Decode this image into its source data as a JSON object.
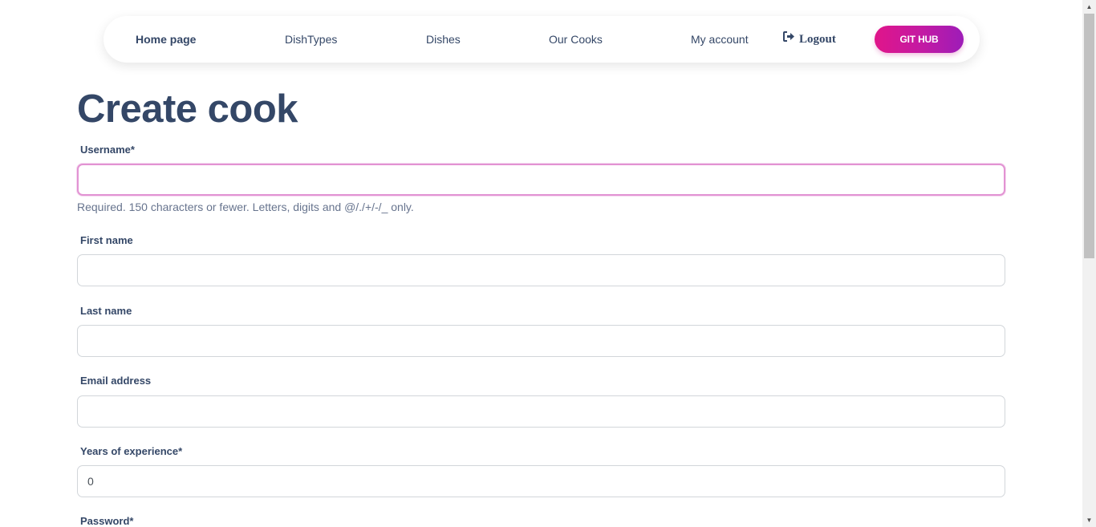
{
  "nav": {
    "items": [
      {
        "label": "Home page"
      },
      {
        "label": "DishTypes"
      },
      {
        "label": "Dishes"
      },
      {
        "label": "Our Cooks"
      },
      {
        "label": "My account"
      }
    ],
    "logout_label": "Logout",
    "github_label": "GIT HUB"
  },
  "page": {
    "title": "Create cook"
  },
  "form": {
    "username": {
      "label": "Username*",
      "value": "",
      "help": "Required. 150 characters or fewer. Letters, digits and @/./+/-/_ only."
    },
    "first_name": {
      "label": "First name",
      "value": ""
    },
    "last_name": {
      "label": "Last name",
      "value": ""
    },
    "email": {
      "label": "Email address",
      "value": ""
    },
    "years_of_experience": {
      "label": "Years of experience*",
      "value": "0"
    },
    "password": {
      "label": "Password*"
    }
  },
  "colors": {
    "primary_text": "#344767",
    "muted_text": "#67748e",
    "focus_border": "#e293d3",
    "github_gradient_start": "#e0158a",
    "github_gradient_end": "#9d1cb8"
  }
}
